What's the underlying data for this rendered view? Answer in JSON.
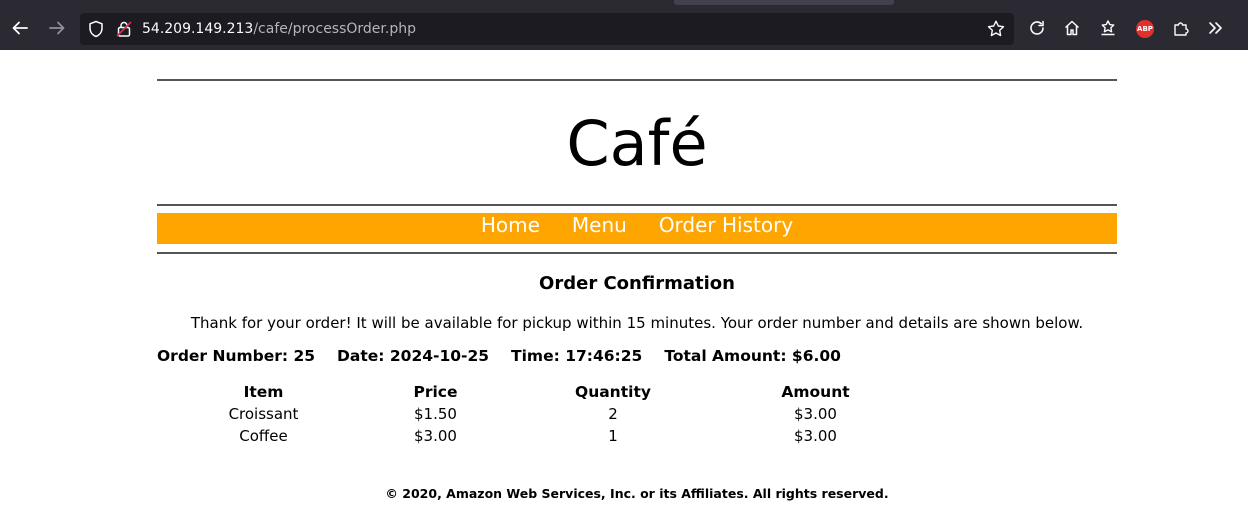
{
  "browser": {
    "url_host": "54.209.149.213",
    "url_path": "/cafe/processOrder.php",
    "icons": {
      "back": "back-arrow-icon",
      "forward": "forward-arrow-icon",
      "shield": "tracking-protection-icon",
      "lock": "insecure-lock-icon",
      "bookmark": "bookmark-star-icon",
      "reload": "reload-icon",
      "home": "home-icon",
      "pocket": "saved-items-icon",
      "adblock": "adblock-plus-icon",
      "extensions": "extensions-icon",
      "overflow": "overflow-chevron-icon"
    },
    "adblock_label": "ABP"
  },
  "site": {
    "title": "Café",
    "nav": [
      {
        "label": "Home"
      },
      {
        "label": "Menu"
      },
      {
        "label": "Order History"
      }
    ],
    "nav_color": "#ffa500"
  },
  "confirmation": {
    "heading": "Order Confirmation",
    "message": "Thank for your order! It will be available for pickup within 15 minutes. Your order number and details are shown below.",
    "order_number": "Order Number: 25",
    "date": "Date: 2024-10-25",
    "time": "Time: 17:46:25",
    "total": "Total Amount: $6.00",
    "columns": [
      "Item",
      "Price",
      "Quantity",
      "Amount"
    ],
    "rows": [
      [
        "Croissant",
        "$1.50",
        "2",
        "$3.00"
      ],
      [
        "Coffee",
        "$3.00",
        "1",
        "$3.00"
      ]
    ]
  },
  "footer": {
    "text": "© 2020, Amazon Web Services, Inc. or its Affiliates. All rights reserved."
  }
}
